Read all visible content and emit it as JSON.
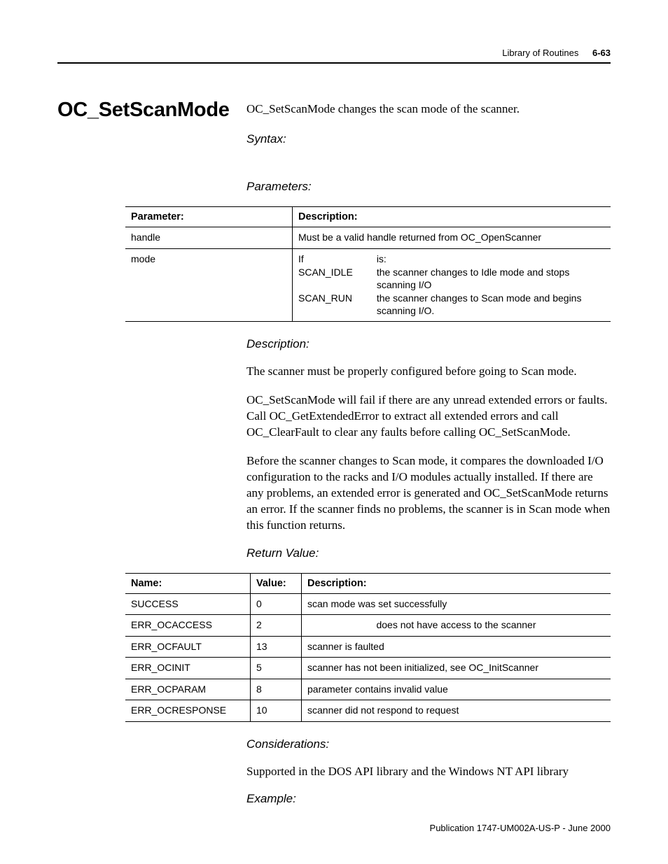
{
  "header": {
    "section": "Library of Routines",
    "pagenum": "6-63"
  },
  "title": "OC_SetScanMode",
  "intro": "OC_SetScanMode changes the scan mode of the scanner.",
  "labels": {
    "syntax": "Syntax:",
    "parameters": "Parameters:",
    "description": "Description:",
    "return_value": "Return Value:",
    "considerations": "Considerations:",
    "example": "Example:"
  },
  "param_table": {
    "headers": {
      "parameter": "Parameter:",
      "description": "Description:"
    },
    "rows": [
      {
        "param": "handle",
        "desc": "Must be a valid handle returned from OC_OpenScanner"
      }
    ],
    "mode_row": {
      "param": "mode",
      "if_label": "If",
      "is_label": "is:",
      "opts": [
        {
          "code": "SCAN_IDLE",
          "desc": "the scanner changes to Idle mode and stops scanning I/O"
        },
        {
          "code": "SCAN_RUN",
          "desc": "the scanner changes to Scan mode and begins scanning I/O."
        }
      ]
    }
  },
  "description_paragraphs": [
    "The scanner must be properly configured before going to Scan mode.",
    "OC_SetScanMode will fail if there are any unread extended errors or faults. Call OC_GetExtendedError to extract all extended errors and call OC_ClearFault to clear any faults before calling OC_SetScanMode.",
    "Before the scanner changes to Scan mode, it compares the downloaded I/O configuration to the racks and I/O modules actually installed. If there are any problems, an extended error is generated and OC_SetScanMode returns an error. If the scanner finds no problems, the scanner is in Scan mode when this function returns."
  ],
  "retval_table": {
    "headers": {
      "name": "Name:",
      "value": "Value:",
      "description": "Description:"
    },
    "rows": [
      {
        "name": "SUCCESS",
        "value": "0",
        "desc": "scan mode was set successfully"
      },
      {
        "name": "ERR_OCACCESS",
        "value": "2",
        "desc": "does not have access to the scanner",
        "center": true
      },
      {
        "name": "ERR_OCFAULT",
        "value": "13",
        "desc": "scanner is faulted"
      },
      {
        "name": "ERR_OCINIT",
        "value": "5",
        "desc": "scanner has not been initialized, see OC_InitScanner"
      },
      {
        "name": "ERR_OCPARAM",
        "value": "8",
        "desc": "parameter contains invalid value"
      },
      {
        "name": "ERR_OCRESPONSE",
        "value": "10",
        "desc": "scanner did not respond to request"
      }
    ]
  },
  "considerations_text": "Supported in the DOS API library and the Windows NT API library",
  "footer": "Publication 1747-UM002A-US-P - June 2000"
}
